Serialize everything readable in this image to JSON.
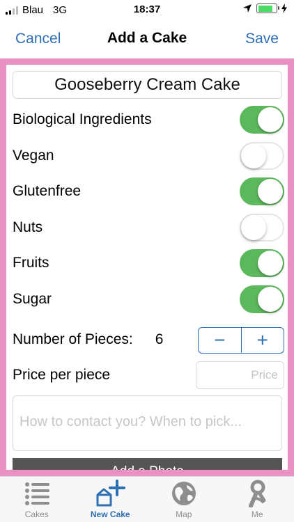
{
  "status_bar": {
    "carrier": "Blau",
    "network": "3G",
    "time": "18:37"
  },
  "nav": {
    "cancel_label": "Cancel",
    "title": "Add a Cake",
    "save_label": "Save"
  },
  "form": {
    "cake_name": "Gooseberry Cream Cake",
    "toggles": [
      {
        "label": "Biological Ingredients",
        "on": true
      },
      {
        "label": "Vegan",
        "on": false
      },
      {
        "label": "Glutenfree",
        "on": true
      },
      {
        "label": "Nuts",
        "on": false
      },
      {
        "label": "Fruits",
        "on": true
      },
      {
        "label": "Sugar",
        "on": true
      }
    ],
    "pieces_label": "Number of Pieces:",
    "pieces_value": "6",
    "stepper_minus": "−",
    "stepper_plus": "+",
    "price_label": "Price per piece",
    "price_placeholder": "Price",
    "contact_placeholder": "How to contact you? When to pick...",
    "photo_button_label": "Add a Photo"
  },
  "tabs": [
    {
      "label": "Cakes",
      "icon": "list-icon",
      "active": false
    },
    {
      "label": "New Cake",
      "icon": "add-cake-icon",
      "active": true
    },
    {
      "label": "Map",
      "icon": "globe-icon",
      "active": false
    },
    {
      "label": "Me",
      "icon": "person-icon",
      "active": false
    }
  ],
  "colors": {
    "accent": "#2f6fb3",
    "frame": "#e891c2",
    "switch_on": "#5cb85c",
    "battery": "#4cd964",
    "photo_button": "#555555"
  }
}
